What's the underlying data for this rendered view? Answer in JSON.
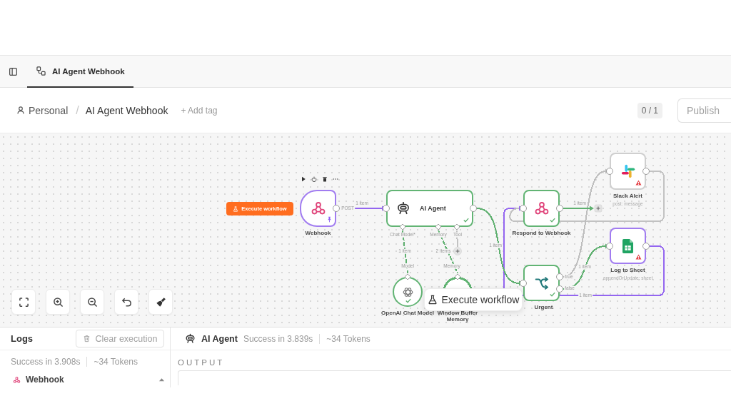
{
  "tab_bar": {
    "tabs": [
      {
        "label": "AI Agent Webhook",
        "selected": true
      }
    ]
  },
  "header": {
    "breadcrumb": [
      "Personal",
      "AI Agent Webhook"
    ],
    "separator": "/",
    "add_tag": "+ Add tag",
    "version": "0 / 1",
    "publish": {
      "label": "Publish",
      "disabled": true
    }
  },
  "canvas": {
    "trigger_button": "Execute workflow",
    "nodes": [
      {
        "kind": "webhook",
        "label": "Webhook",
        "color": "#a17cf0",
        "success": false,
        "warning": false,
        "pinned": true
      },
      {
        "kind": "agent",
        "label": "AI Agent",
        "color": "#62b474",
        "success": true,
        "warning": false,
        "pinned": false
      },
      {
        "kind": "model",
        "label": "OpenAI Chat Model",
        "color": "#62b474",
        "success": true,
        "warning": false,
        "pinned": false
      },
      {
        "kind": "memory",
        "label": "Window Buffer Memory",
        "color": "#62b474"
      },
      {
        "kind": "respond",
        "label": "Respond to Webhook",
        "color": "#62b474",
        "success": true,
        "warning": false,
        "pinned": false
      },
      {
        "kind": "slack",
        "label": "Slack Alert",
        "subtitle": "post: message",
        "color": "#cfcfcf",
        "success": false,
        "warning": true,
        "pinned": false
      },
      {
        "kind": "if",
        "label": "Urgent",
        "color": "#62b474",
        "success": true,
        "warning": false,
        "pinned": false
      },
      {
        "kind": "sheets",
        "label": "Log to Sheet",
        "subtitle": "appendOrUpdate: sheet",
        "color": "#a17cf0",
        "success": false,
        "warning": true,
        "pinned": false
      }
    ],
    "edges": [
      {
        "kind": "main",
        "color": "#9466f0",
        "label": "1 item"
      },
      {
        "kind": "main",
        "color": "#5fb070",
        "label": "1 item"
      },
      {
        "kind": "main",
        "color": "#5fb070",
        "label": "1 item"
      },
      {
        "kind": "main",
        "color": "#bdbdbd"
      },
      {
        "kind": "main",
        "color": "#5fb070",
        "label": "1 item"
      },
      {
        "kind": "main",
        "color": "#9466f0",
        "label": "1 item"
      },
      {
        "kind": "main",
        "color": "#c2c2c2"
      },
      {
        "kind": "sub",
        "color": "#5fb070",
        "label": "1 item"
      },
      {
        "kind": "sub",
        "color": "#5fb070",
        "label": "2 items"
      },
      {
        "kind": "main",
        "color": "#c2c2c2"
      }
    ],
    "port_labels": [
      "POST",
      "Chat Model*",
      "Memory",
      "Tool",
      "Model",
      "Memory",
      "true",
      "false"
    ],
    "execute_button": "Execute workflow"
  },
  "logs": {
    "title": "Logs",
    "clear_button": "Clear execution",
    "summary": [
      "Success in 3.908s",
      "~34 Tokens"
    ],
    "entries": [
      {
        "kind": "webhook",
        "label": "Webhook"
      }
    ]
  },
  "output": {
    "node": "AI Agent",
    "meta": [
      "Success in 3.839s",
      "~34 Tokens"
    ],
    "section": "OUTPUT"
  }
}
